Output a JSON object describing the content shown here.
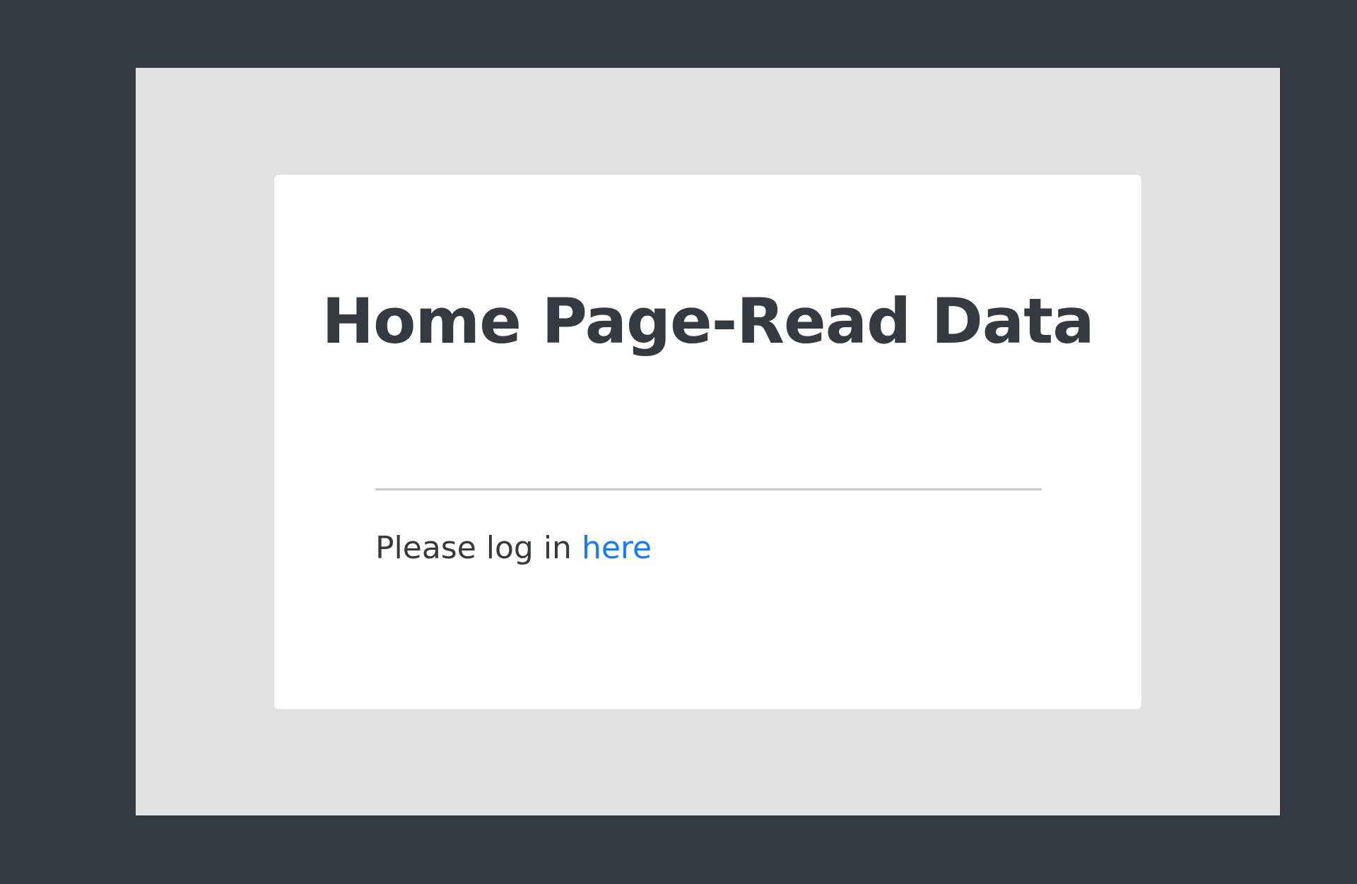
{
  "page": {
    "title": "Home Page-Read Data",
    "message_prefix": "Please log in ",
    "link_text": "here"
  },
  "colors": {
    "background": "#343a42",
    "panel": "#e1e2e4",
    "card": "#ffffff",
    "text": "#343a40",
    "link": "#1a7bf0",
    "rule": "#c9cbcd"
  }
}
